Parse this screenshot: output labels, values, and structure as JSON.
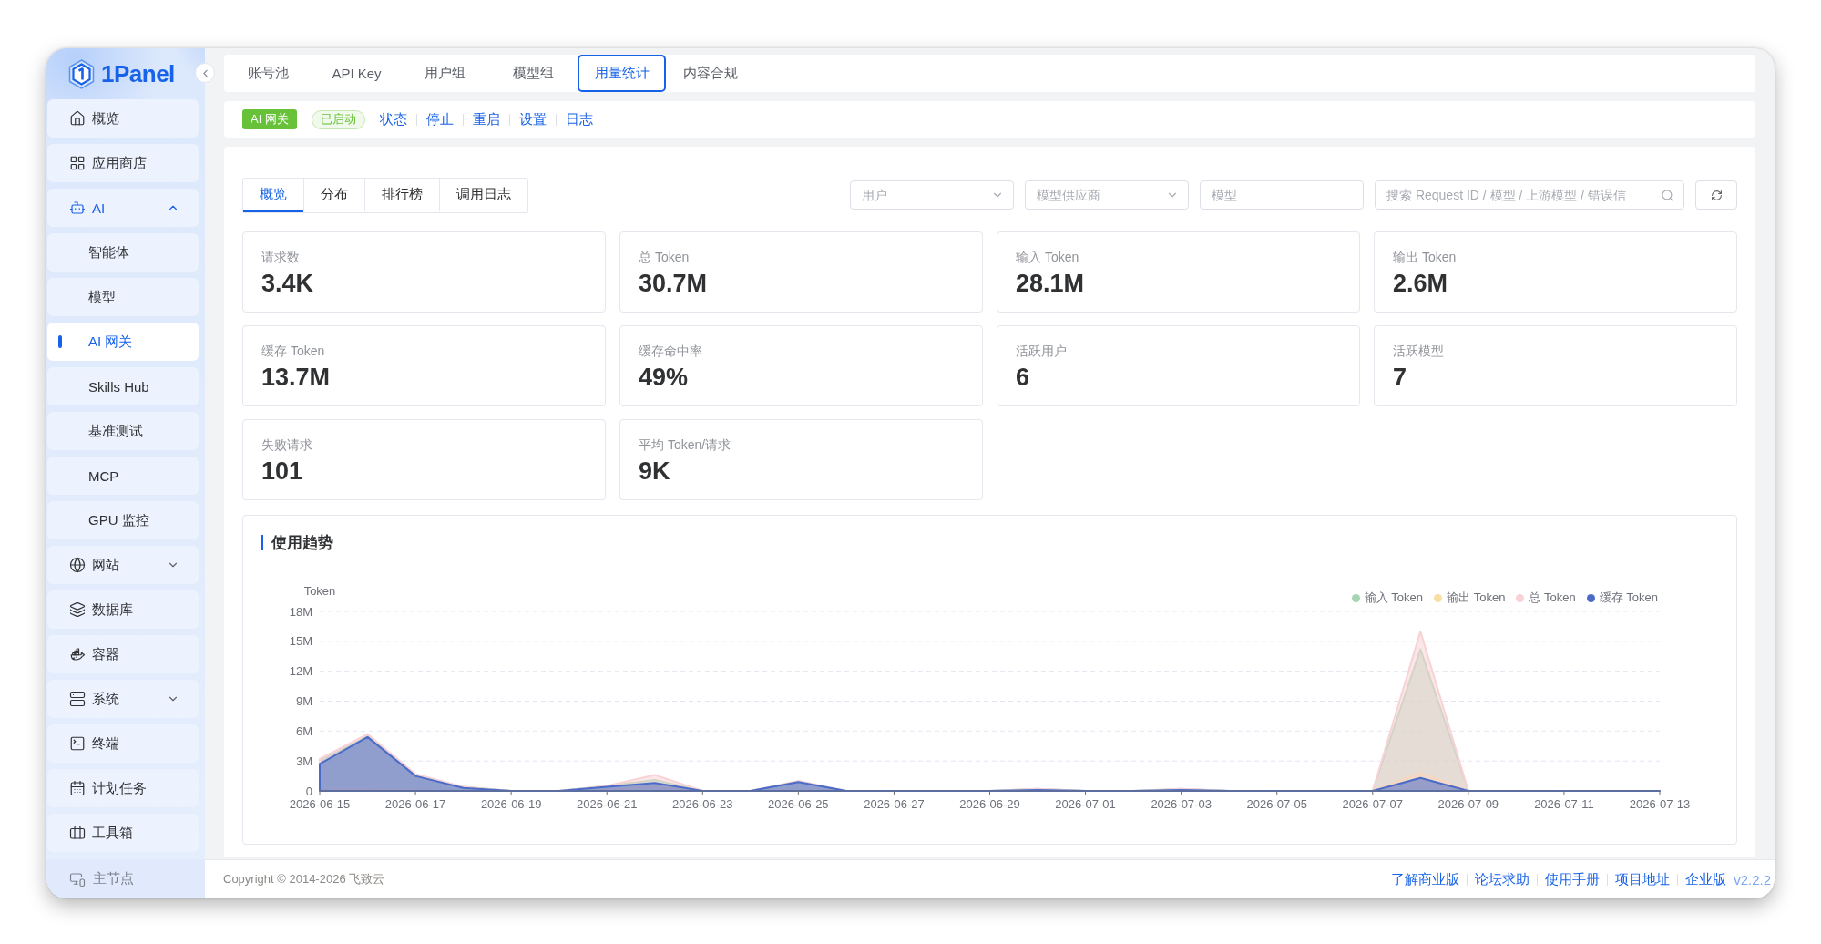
{
  "sidebar": {
    "logo": "1Panel",
    "items": [
      {
        "kind": "link",
        "label": "概览",
        "selected": false
      },
      {
        "kind": "link",
        "label": "应用商店",
        "selected": false
      },
      {
        "kind": "group",
        "label": "AI",
        "selected": true,
        "expanded": true,
        "children": [
          {
            "label": "智能体",
            "selected": false
          },
          {
            "label": "模型",
            "selected": false
          },
          {
            "label": "AI 网关",
            "selected": true
          },
          {
            "label": "Skills Hub",
            "selected": false
          },
          {
            "label": "基准测试",
            "selected": false
          },
          {
            "label": "MCP",
            "selected": false
          },
          {
            "label": "GPU 监控",
            "selected": false
          }
        ]
      },
      {
        "kind": "group",
        "label": "网站",
        "selected": false,
        "expanded": false
      },
      {
        "kind": "link",
        "label": "数据库",
        "selected": false
      },
      {
        "kind": "link",
        "label": "容器",
        "selected": false
      },
      {
        "kind": "group",
        "label": "系统",
        "selected": false,
        "expanded": false
      },
      {
        "kind": "link",
        "label": "终端",
        "selected": false
      },
      {
        "kind": "link",
        "label": "计划任务",
        "selected": false
      },
      {
        "kind": "link",
        "label": "工具箱",
        "selected": false
      }
    ],
    "node": "主节点"
  },
  "top_tabs": [
    {
      "label": "账号池",
      "selected": false
    },
    {
      "label": "API Key",
      "selected": false
    },
    {
      "label": "用户组",
      "selected": false
    },
    {
      "label": "模型组",
      "selected": false
    },
    {
      "label": "用量统计",
      "selected": true
    },
    {
      "label": "内容合规",
      "selected": false
    }
  ],
  "service": {
    "name": "AI 网关",
    "status": {
      "label": "已启动",
      "kind": "running"
    },
    "actions": [
      "状态",
      "停止",
      "重启",
      "设置",
      "日志"
    ]
  },
  "view_tabs": [
    {
      "label": "概览",
      "selected": true
    },
    {
      "label": "分布",
      "selected": false
    },
    {
      "label": "排行榜",
      "selected": false
    },
    {
      "label": "调用日志",
      "selected": false
    }
  ],
  "filters": {
    "user": {
      "placeholder": "用户"
    },
    "provider": {
      "placeholder": "模型供应商"
    },
    "model": {
      "placeholder": "模型"
    },
    "search": {
      "placeholder": "搜索 Request ID / 模型 / 上游模型 / 错误信"
    }
  },
  "stats": [
    {
      "label": "请求数",
      "value": "3.4K"
    },
    {
      "label": "总 Token",
      "value": "30.7M"
    },
    {
      "label": "输入 Token",
      "value": "28.1M"
    },
    {
      "label": "输出 Token",
      "value": "2.6M"
    },
    {
      "label": "缓存 Token",
      "value": "13.7M"
    },
    {
      "label": "缓存命中率",
      "value": "49%"
    },
    {
      "label": "活跃用户",
      "value": "6"
    },
    {
      "label": "活跃模型",
      "value": "7"
    },
    {
      "label": "失败请求",
      "value": "101"
    },
    {
      "label": "平均 Token/请求",
      "value": "9K"
    }
  ],
  "usage_trend": {
    "title": "使用趋势",
    "chart_data": {
      "type": "area",
      "ylabel": "Token",
      "grid": true,
      "legend": "top-right",
      "categories": [
        "2026-06-15",
        null,
        "2026-06-17",
        null,
        "2026-06-19",
        null,
        "2026-06-21",
        null,
        "2026-06-23",
        null,
        "2026-06-25",
        null,
        "2026-06-27",
        null,
        "2026-06-29",
        null,
        "2026-07-01",
        null,
        "2026-07-03",
        null,
        "2026-07-05",
        null,
        "2026-07-07",
        null,
        "2026-07-09",
        null,
        "2026-07-11",
        null,
        "2026-07-13"
      ],
      "ylim": [
        0,
        18
      ],
      "yticks": [
        0,
        {
          "value": 3,
          "label": "3M"
        },
        {
          "value": 6,
          "label": "6M"
        },
        {
          "value": 9,
          "label": "9M"
        },
        {
          "value": 12,
          "label": "12M"
        },
        {
          "value": 15,
          "label": "15M"
        },
        {
          "value": 18,
          "label": "18M"
        }
      ],
      "series": [
        {
          "name": "输入 Token",
          "color": "#a6d5b4",
          "values": [
            3.0,
            5.5,
            1.6,
            0.4,
            0,
            0,
            0.5,
            1.1,
            0,
            0,
            0.9,
            0,
            0,
            0,
            0,
            0.2,
            0,
            0,
            0.2,
            0,
            0,
            0,
            0,
            14.2,
            0,
            0,
            0,
            0,
            0
          ]
        },
        {
          "name": "输出 Token",
          "color": "#f9dea2",
          "values": [
            0.2,
            0.2,
            0.1,
            0,
            0,
            0,
            0.1,
            0.5,
            0,
            0,
            0.1,
            0,
            0,
            0,
            0,
            0,
            0,
            0,
            0,
            0,
            0,
            0,
            0,
            1.8,
            0,
            0,
            0,
            0,
            0
          ]
        },
        {
          "name": "总 Token",
          "color": "#f8d2d5",
          "values": [
            3.2,
            5.7,
            1.7,
            0.4,
            0,
            0,
            0.5,
            1.6,
            0,
            0,
            1.0,
            0,
            0,
            0,
            0,
            0.2,
            0,
            0,
            0.2,
            0,
            0,
            0,
            0,
            16.0,
            0,
            0,
            0,
            0,
            0
          ]
        },
        {
          "name": "缓存 Token",
          "color": "#4a6cc8",
          "values": [
            2.7,
            5.4,
            1.5,
            0.3,
            0,
            0,
            0.4,
            0.8,
            0,
            0,
            0.9,
            0,
            0,
            0,
            0,
            0.1,
            0,
            0,
            0.1,
            0,
            0,
            0,
            0,
            1.3,
            0,
            0,
            0,
            0,
            0
          ]
        }
      ]
    }
  },
  "footer": {
    "copyright": "Copyright © 2014-2026 飞致云",
    "links": [
      "了解商业版",
      "论坛求助",
      "使用手册",
      "项目地址",
      "企业版"
    ],
    "version": "v2.2.2"
  }
}
